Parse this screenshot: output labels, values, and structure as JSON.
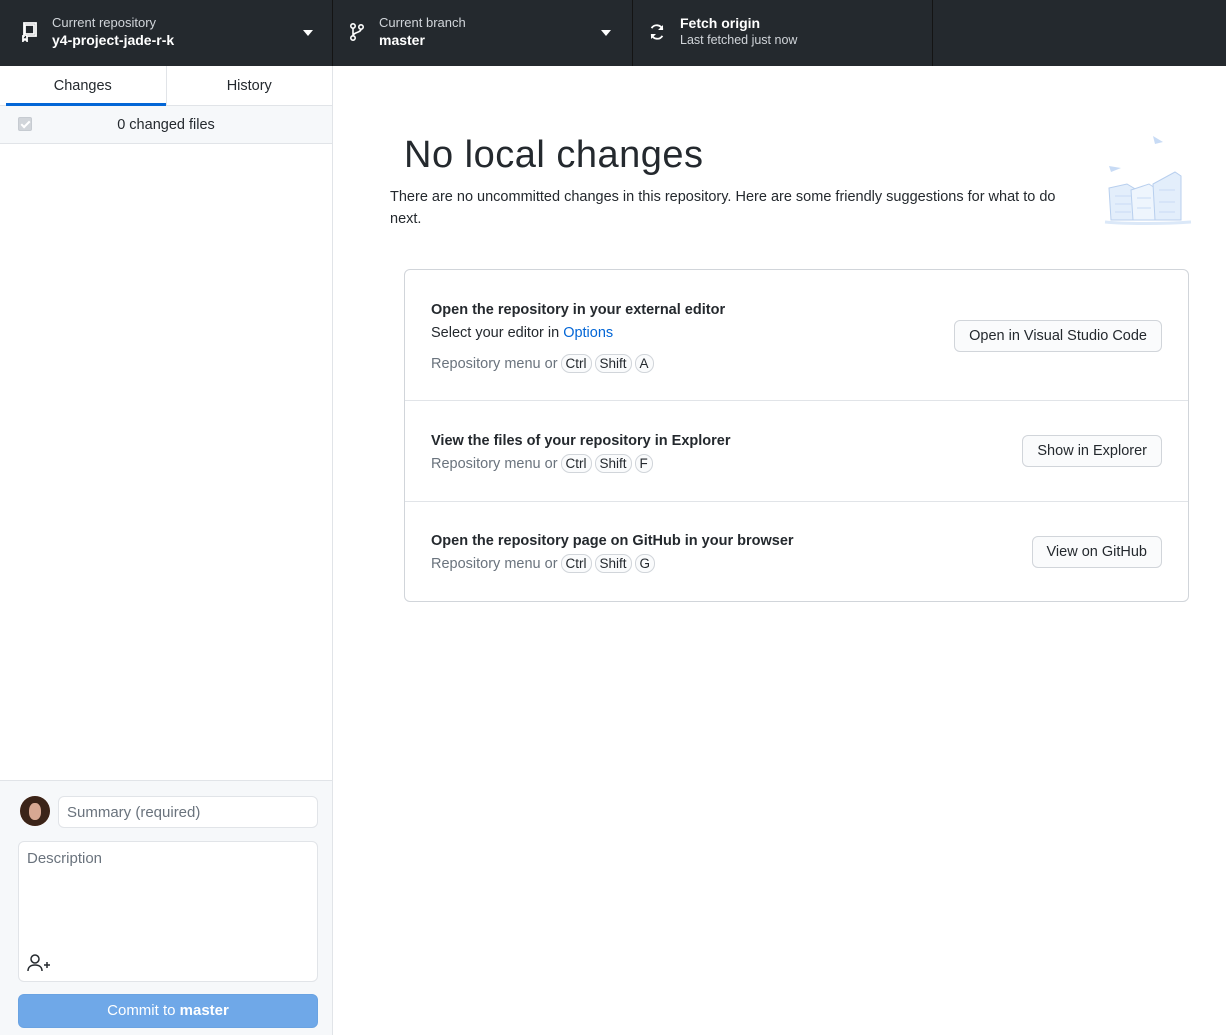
{
  "toolbar": {
    "repository": {
      "label": "Current repository",
      "value": "y4-project-jade-r-k",
      "icon": "repo-icon"
    },
    "branch": {
      "label": "Current branch",
      "value": "master",
      "icon": "git-branch-icon"
    },
    "fetch": {
      "label": "Fetch origin",
      "sub": "Last fetched just now",
      "icon": "sync-icon"
    }
  },
  "sidebar": {
    "tabs": [
      {
        "label": "Changes",
        "active": true
      },
      {
        "label": "History",
        "active": false
      }
    ],
    "changes_count": "0 changed files",
    "commit": {
      "summary_placeholder": "Summary (required)",
      "description_placeholder": "Description",
      "button_prefix": "Commit to",
      "button_branch": "master"
    }
  },
  "main": {
    "title": "No local changes",
    "intro": "There are no uncommitted changes in this repository. Here are some friendly suggestions for what to do next.",
    "suggestions": [
      {
        "title": "Open the repository in your external editor",
        "line_prefix": "Select your editor in ",
        "line_link": "Options",
        "hint_prefix": "Repository menu or",
        "keys": [
          "Ctrl",
          "Shift",
          "A"
        ],
        "button": "Open in Visual Studio Code"
      },
      {
        "title": "View the files of your repository in Explorer",
        "hint_prefix": "Repository menu or",
        "keys": [
          "Ctrl",
          "Shift",
          "F"
        ],
        "button": "Show in Explorer"
      },
      {
        "title": "Open the repository page on GitHub in your browser",
        "hint_prefix": "Repository menu or",
        "keys": [
          "Ctrl",
          "Shift",
          "G"
        ],
        "button": "View on GitHub"
      }
    ]
  },
  "colors": {
    "toolbar_bg": "#24292e",
    "accent": "#0366d6",
    "commit_button": "#6fa8e8"
  }
}
